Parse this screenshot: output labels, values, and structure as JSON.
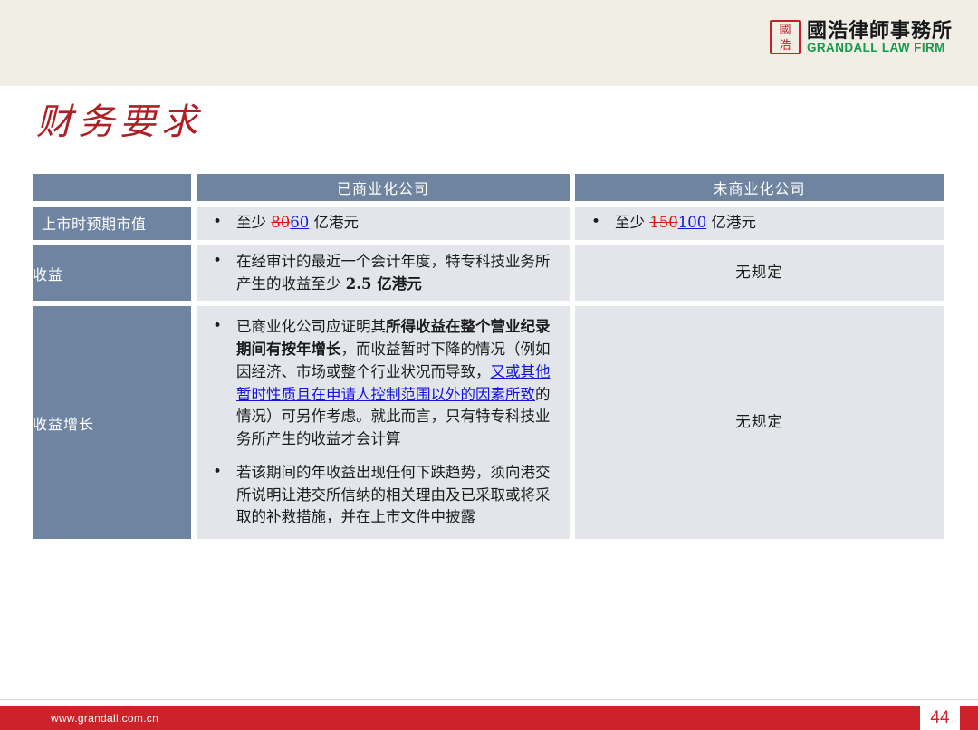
{
  "header": {
    "logo": {
      "seal_top": "國",
      "seal_bottom": "浩",
      "chinese_name": "國浩律師事務所",
      "english_name": "GRANDALL LAW FIRM"
    }
  },
  "slide": {
    "title": "财务要求"
  },
  "table": {
    "columns": {
      "label_header": "",
      "commercial_header": "已商业化公司",
      "precommercial_header": "未商业化公司"
    },
    "rows": [
      {
        "label": "上市时预期市值",
        "commercial": {
          "bullets": [
            {
              "parts": [
                {
                  "text": "至少 ",
                  "style": "normal"
                },
                {
                  "text": "80",
                  "style": "deleted"
                },
                {
                  "text": "60",
                  "style": "inserted"
                },
                {
                  "text": " 亿港元",
                  "style": "normal"
                }
              ]
            }
          ]
        },
        "precommercial": {
          "bullets": [
            {
              "parts": [
                {
                  "text": "至少 ",
                  "style": "normal"
                },
                {
                  "text": "150",
                  "style": "deleted"
                },
                {
                  "text": "100",
                  "style": "inserted"
                },
                {
                  "text": " 亿港元",
                  "style": "normal"
                }
              ]
            }
          ]
        }
      },
      {
        "label": "收益",
        "commercial": {
          "bullets": [
            {
              "parts": [
                {
                  "text": "在经审计的最近一个会计年度，特专科技业务所产生的收益至少 ",
                  "style": "normal"
                },
                {
                  "text": "2.5 亿港元",
                  "style": "bold"
                }
              ]
            }
          ]
        },
        "precommercial": {
          "plain": "无规定"
        }
      },
      {
        "label": "收益增长",
        "commercial": {
          "bullets": [
            {
              "parts": [
                {
                  "text": "已商业化公司应证明其",
                  "style": "normal"
                },
                {
                  "text": "所得收益在整个营业纪录期间有按年增长",
                  "style": "bold"
                },
                {
                  "text": "，而收益暂时下降的情况（例如因经济、市场或整个行业状况而导致，",
                  "style": "normal"
                },
                {
                  "text": "又或其他暂时性质且在申请人控制范围以外的因素所致",
                  "style": "inserted"
                },
                {
                  "text": "的情况）可另作考虑。就此而言，只有特专科技业务所产生的收益才会计算",
                  "style": "normal"
                }
              ]
            },
            {
              "parts": [
                {
                  "text": "若该期间的年收益出现任何下跌趋势，须向港交所说明让港交所信纳的相关理由及已采取或将采取的补救措施，并在上市文件中披露",
                  "style": "normal"
                }
              ]
            }
          ]
        },
        "precommercial": {
          "plain": "无规定"
        }
      }
    ]
  },
  "footer": {
    "url": "www.grandall.com.cn",
    "page_number": "44"
  },
  "colors": {
    "brand_red": "#cc2229",
    "title_red": "#b01f24",
    "header_band": "#f1eee6",
    "table_header": "#6f84a0",
    "table_body": "#e2e5ea",
    "inserted_blue": "#1414e0",
    "deleted_red": "#e01414",
    "logo_green": "#169b4c"
  }
}
